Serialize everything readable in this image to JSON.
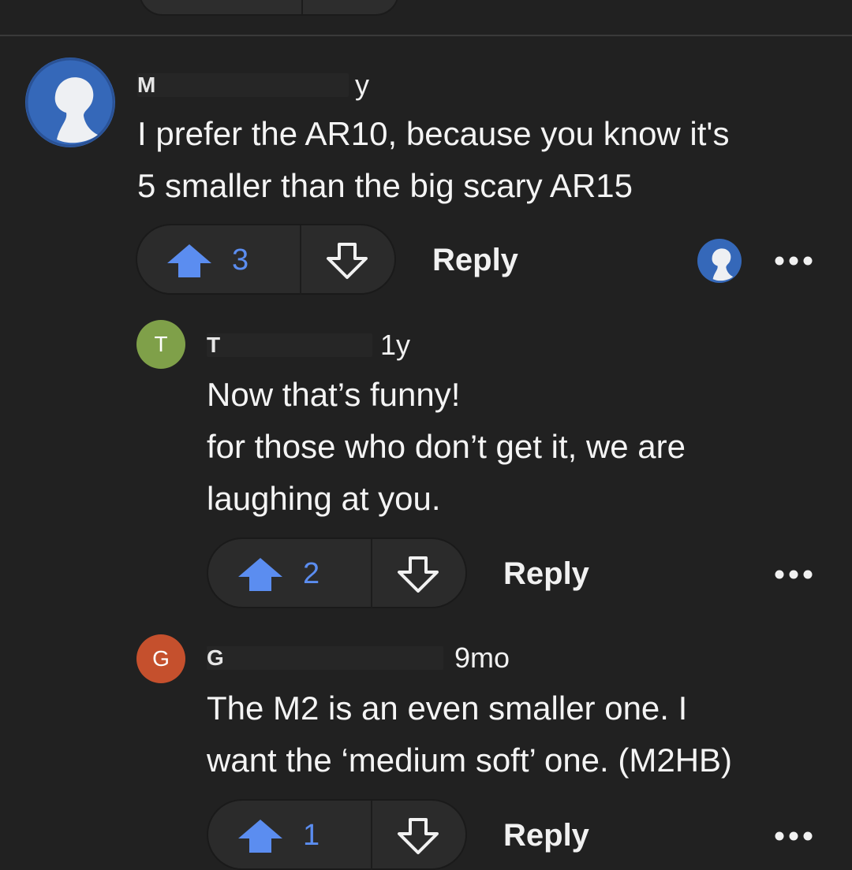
{
  "comments": [
    {
      "author_visible": "M",
      "age": "y",
      "text": "I prefer the AR10, because you know it's\n5 smaller than the big scary AR15",
      "votes": "3",
      "reply_label": "Reply"
    },
    {
      "avatar_letter": "T",
      "avatar_color": "#7fa049",
      "author_visible": "T",
      "age": "1y",
      "text": "Now that’s funny!\nfor those who don’t get it, we are\nlaughing at you.",
      "votes": "2",
      "reply_label": "Reply"
    },
    {
      "avatar_letter": "G",
      "avatar_color": "#c5502d",
      "author_visible": "G",
      "age": "9mo",
      "text": "The M2 is an even smaller one. I\nwant the ‘medium soft’ one. (M2HB)",
      "votes": "1",
      "reply_label": "Reply"
    }
  ],
  "colors": {
    "background": "#212121",
    "vote_blue": "#5b8df0",
    "avatar_blue": "#3568b9"
  }
}
